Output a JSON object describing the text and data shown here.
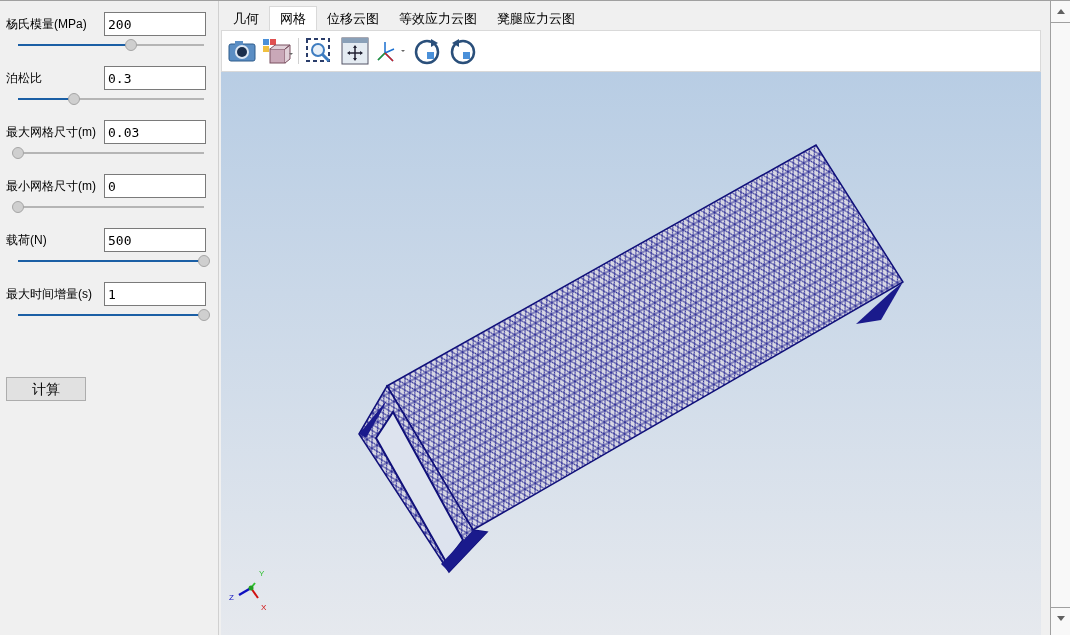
{
  "parameters": [
    {
      "label": "杨氏模量(MPa)",
      "value": "200",
      "level": 0.61
    },
    {
      "label": "泊松比",
      "value": "0.3",
      "level": 0.3
    },
    {
      "label": "最大网格尺寸(m)",
      "value": "0.03",
      "level": 0
    },
    {
      "label": "最小网格尺寸(m)",
      "value": "0",
      "level": 0
    },
    {
      "label": "载荷(N)",
      "value": "500",
      "level": 1
    },
    {
      "label": "最大时间增量(s)",
      "value": "1",
      "level": 1
    }
  ],
  "compute_button": "计算",
  "tabs": [
    {
      "label": "几何",
      "selected": false
    },
    {
      "label": "网格",
      "selected": true
    },
    {
      "label": "位移云图",
      "selected": false
    },
    {
      "label": "等效应力云图",
      "selected": false
    },
    {
      "label": "凳腿应力云图",
      "selected": false
    }
  ],
  "axis_labels": {
    "z": "Z",
    "y": "Y",
    "x": "X"
  }
}
